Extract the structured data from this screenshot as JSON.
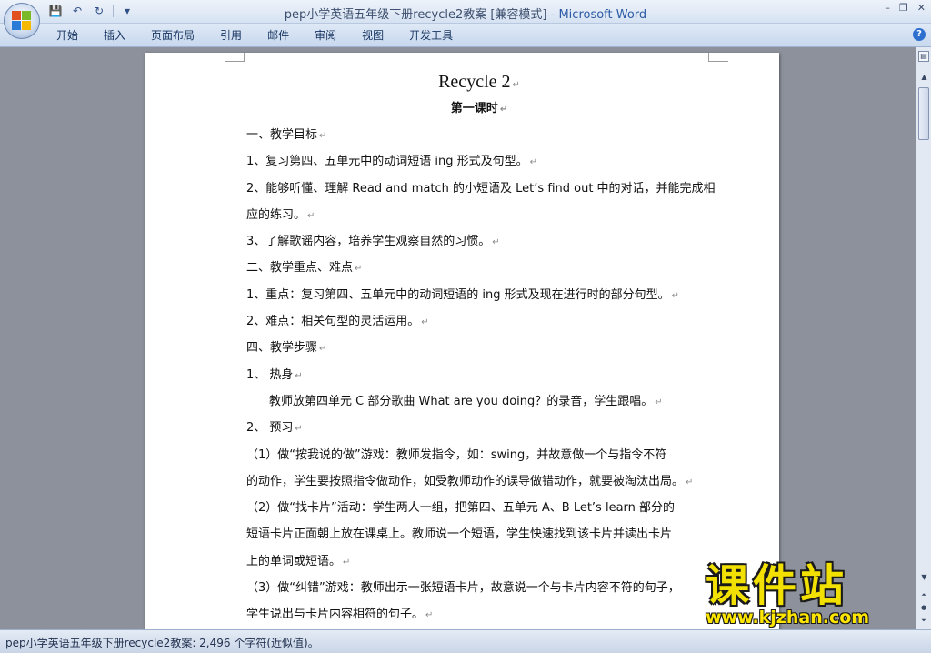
{
  "window": {
    "title": "pep小学英语五年级下册recycle2教案 [兼容模式] - ",
    "app_name": "Microsoft Word",
    "controls": [
      "–",
      "❐",
      "✕"
    ]
  },
  "quick_access": {
    "save": "💾",
    "undo": "↶",
    "redo": "↻",
    "more": "▾"
  },
  "ribbon": {
    "tabs": [
      "开始",
      "插入",
      "页面布局",
      "引用",
      "邮件",
      "审阅",
      "视图",
      "开发工具"
    ],
    "help": "?"
  },
  "document": {
    "title": "Recycle 2",
    "subtitle": "第一课时",
    "paragraph_mark": "↵",
    "lines": [
      {
        "text": "一、教学目标",
        "indent": false,
        "mark": true
      },
      {
        "text": "1、复习第四、五单元中的动词短语 ing 形式及句型。",
        "indent": false,
        "mark": true
      },
      {
        "text": "2、能够听懂、理解 Read and match 的小短语及 Let’s find out 中的对话，并能完成相",
        "indent": false,
        "mark": false
      },
      {
        "text": "应的练习。",
        "indent": false,
        "mark": true
      },
      {
        "text": "3、了解歌谣内容，培养学生观察自然的习惯。",
        "indent": false,
        "mark": true
      },
      {
        "text": "二、教学重点、难点",
        "indent": false,
        "mark": true
      },
      {
        "text": "1、重点：复习第四、五单元中的动词短语的 ing 形式及现在进行时的部分句型。",
        "indent": false,
        "mark": true
      },
      {
        "text": "2、难点：相关句型的灵活运用。",
        "indent": false,
        "mark": true
      },
      {
        "text": "四、教学步骤",
        "indent": false,
        "mark": true
      },
      {
        "text": "1、 热身",
        "indent": false,
        "mark": true
      },
      {
        "text": "教师放第四单元 C 部分歌曲 What are you doing？的录音，学生跟唱。",
        "indent": true,
        "mark": true
      },
      {
        "text": "2、 预习",
        "indent": false,
        "mark": true
      },
      {
        "text": "（1）做“按我说的做”游戏：教师发指令，如：swing，并故意做一个与指令不符",
        "indent": false,
        "mark": false
      },
      {
        "text": "的动作，学生要按照指令做动作，如受教师动作的误导做错动作，就要被淘汰出局。",
        "indent": false,
        "mark": true
      },
      {
        "text": "（2）做“找卡片”活动：学生两人一组，把第四、五单元 A、B Let’s learn 部分的",
        "indent": false,
        "mark": false
      },
      {
        "text": "短语卡片正面朝上放在课桌上。教师说一个短语，学生快速找到该卡片并读出卡片",
        "indent": false,
        "mark": false
      },
      {
        "text": "上的单词或短语。",
        "indent": false,
        "mark": true
      },
      {
        "text": "（3）做“纠错”游戏：教师出示一张短语卡片，故意说一个与卡片内容不符的句子，",
        "indent": false,
        "mark": false
      },
      {
        "text": "学生说出与卡片内容相符的句子。",
        "indent": false,
        "mark": true
      }
    ]
  },
  "status_bar": {
    "text": "pep小学英语五年级下册recycle2教案: 2,496 个字符(近似值)。"
  },
  "watermark": {
    "chinese": "课件站",
    "url": "www.kjzhan.com"
  },
  "colors": {
    "title_app": "#2c5aa6",
    "workspace": "#8c919b",
    "watermark_yellow": "#f2e000"
  }
}
